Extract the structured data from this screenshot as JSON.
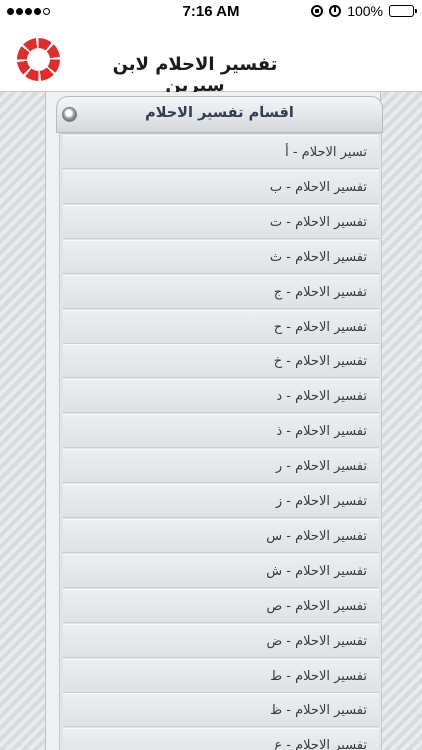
{
  "status_bar": {
    "time": "7:16 AM",
    "battery_percent": "100%",
    "battery_level": 1.0,
    "signal_bars_filled": 4,
    "signal_bars_total": 5
  },
  "header": {
    "app_title": "تفسير الاحلام لابن سيرين",
    "logo_icon": "life-ring-logo",
    "logo_color": "#e52a2a"
  },
  "panel": {
    "title": "اقسام تفسير الاحلام",
    "items": [
      {
        "label": "تسير الاحلام - أ"
      },
      {
        "label": "تفسير الاحلام - ب"
      },
      {
        "label": "تفسير الاحلام - ت"
      },
      {
        "label": "تفسير الاحلام - ث"
      },
      {
        "label": "تفسير الاحلام - ج"
      },
      {
        "label": "تفسير الاحلام - ح"
      },
      {
        "label": "تفسير الاحلام - خ"
      },
      {
        "label": "تفسير الاحلام - د"
      },
      {
        "label": "تفسير الاحلام - ذ"
      },
      {
        "label": "تفسير الاحلام - ر"
      },
      {
        "label": "تفسير الاحلام - ز"
      },
      {
        "label": "تفسير الاحلام - س"
      },
      {
        "label": "تفسير الاحلام - ش"
      },
      {
        "label": "تفسير الاحلام - ص"
      },
      {
        "label": "تفسير الاحلام - ض"
      },
      {
        "label": "تفسير الاحلام - ط"
      },
      {
        "label": "تفسير الاحلام - ظ"
      },
      {
        "label": "تفسير الاحلام - ع"
      }
    ]
  }
}
